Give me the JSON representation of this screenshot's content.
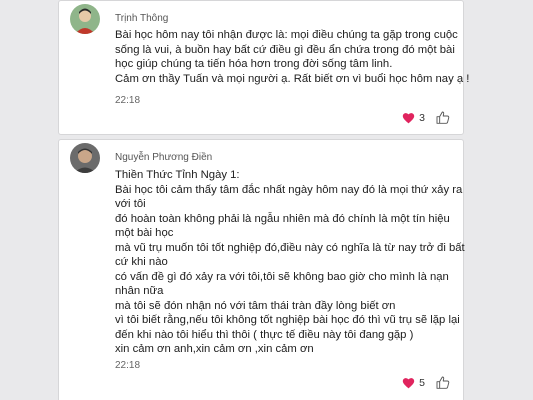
{
  "posts": [
    {
      "author": "Trịnh Thông",
      "lines": [
        "Bài học hôm nay tôi nhận được là: mọi điều chúng ta gặp trong cuộc",
        "sống là vui, à buồn hay bất cứ điều gì đều ẩn chứa trong đó một bài",
        "học giúp chúng ta tiến hóa hơn trong đời sống tâm linh.",
        "Cảm ơn thầy Tuấn và mọi người ạ. Rất biết ơn vì buổi học hôm nay ạ !"
      ],
      "time": "22:18",
      "reaction_count": "3",
      "reaction_icon": "heart-icon",
      "like_icon": "thumbs-up-icon"
    },
    {
      "author": "Nguyễn Phương Điền",
      "lines": [
        "Thiền Thức Tỉnh Ngày 1:",
        "Bài học tôi cảm thấy tâm đắc nhất ngày hôm nay đó là mọi thứ xảy ra",
        "với tôi",
        "đó hoàn toàn không phải là ngẫu nhiên mà đó chính là một tín hiệu",
        "một bài học",
        "mà vũ trụ muốn tôi tốt nghiệp đó,điều này có nghĩa là từ nay trở đi bất",
        "cứ khi nào",
        "có vấn đề gì đó xảy ra với tôi,tôi sẽ không bao giờ cho mình là nạn",
        "nhân nữa",
        "mà tôi sẽ đón nhận nó với tâm thái tràn đầy lòng biết ơn",
        "vì tôi biết rằng,nếu tôi không tốt nghiệp bài học đó thì vũ trụ sẽ lặp lại",
        "đến khi nào tôi hiểu thì thôi ( thực tế điều này tôi đang gặp )",
        "xin cảm ơn anh,xin cảm ơn ,xin cảm ơn"
      ],
      "time": "22:18",
      "reaction_count": "5",
      "reaction_icon": "heart-icon",
      "like_icon": "thumbs-up-icon"
    }
  ],
  "colors": {
    "heart": "#e0245e",
    "background": "#e9e9eb",
    "card": "#ffffff"
  }
}
